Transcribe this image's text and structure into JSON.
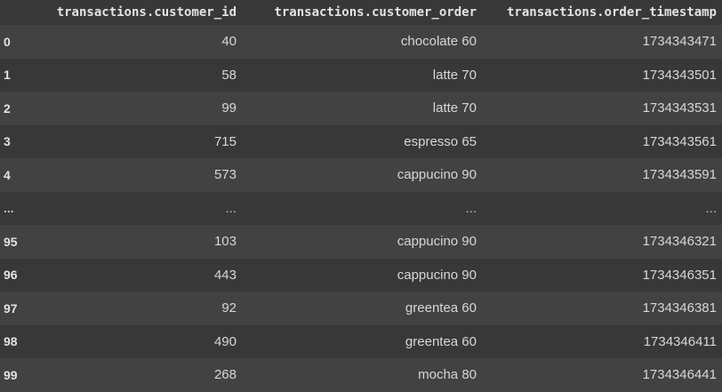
{
  "table": {
    "index_header": "",
    "columns": [
      "transactions.customer_id",
      "transactions.customer_order",
      "transactions.order_timestamp"
    ],
    "rows": [
      {
        "index": "0",
        "customer_id": "40",
        "customer_order": "chocolate 60",
        "order_timestamp": "1734343471"
      },
      {
        "index": "1",
        "customer_id": "58",
        "customer_order": "latte 70",
        "order_timestamp": "1734343501"
      },
      {
        "index": "2",
        "customer_id": "99",
        "customer_order": "latte 70",
        "order_timestamp": "1734343531"
      },
      {
        "index": "3",
        "customer_id": "715",
        "customer_order": "espresso 65",
        "order_timestamp": "1734343561"
      },
      {
        "index": "4",
        "customer_id": "573",
        "customer_order": "cappucino 90",
        "order_timestamp": "1734343591"
      },
      {
        "index": "...",
        "customer_id": "...",
        "customer_order": "...",
        "order_timestamp": "..."
      },
      {
        "index": "95",
        "customer_id": "103",
        "customer_order": "cappucino 90",
        "order_timestamp": "1734346321"
      },
      {
        "index": "96",
        "customer_id": "443",
        "customer_order": "cappucino 90",
        "order_timestamp": "1734346351"
      },
      {
        "index": "97",
        "customer_id": "92",
        "customer_order": "greentea 60",
        "order_timestamp": "1734346381"
      },
      {
        "index": "98",
        "customer_id": "490",
        "customer_order": "greentea 60",
        "order_timestamp": "1734346411"
      },
      {
        "index": "99",
        "customer_id": "268",
        "customer_order": "mocha 80",
        "order_timestamp": "1734346441"
      }
    ]
  }
}
